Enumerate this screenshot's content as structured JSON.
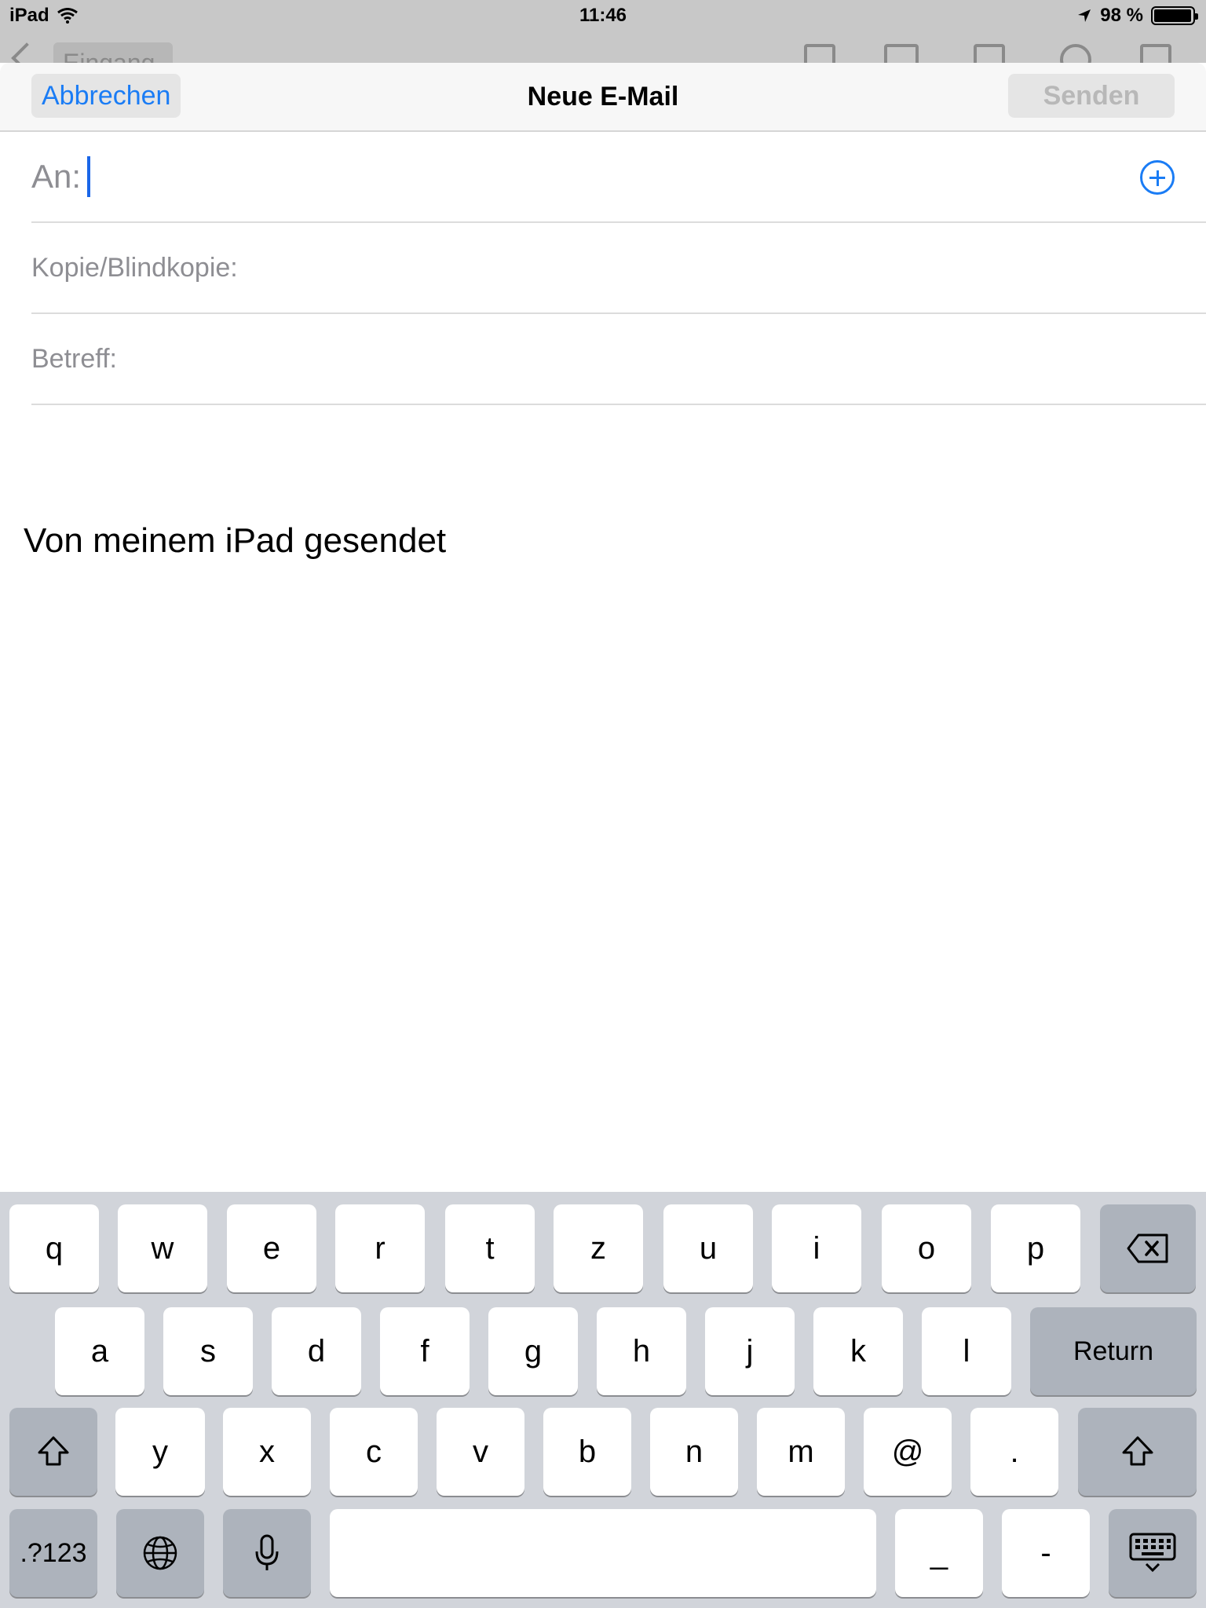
{
  "status_bar": {
    "device": "iPad",
    "time": "11:46",
    "battery_text": "98 %",
    "battery_level": 0.98
  },
  "background_toolbar": {
    "inbox_label": "Eingang"
  },
  "compose": {
    "cancel_label": "Abbrechen",
    "title": "Neue E-Mail",
    "send_label": "Senden",
    "to_label": "An:",
    "to_value": "",
    "cc_label": "Kopie/Blindkopie:",
    "cc_value": "",
    "subject_label": "Betreff:",
    "subject_value": "",
    "signature": "Von meinem iPad gesendet"
  },
  "keyboard": {
    "row1": [
      "q",
      "w",
      "e",
      "r",
      "t",
      "z",
      "u",
      "i",
      "o",
      "p"
    ],
    "row2": [
      "a",
      "s",
      "d",
      "f",
      "g",
      "h",
      "j",
      "k",
      "l"
    ],
    "return_label": "Return",
    "row3": [
      "y",
      "x",
      "c",
      "v",
      "b",
      "n",
      "m",
      "@",
      "."
    ],
    "numbers_label": ".?123",
    "underscore_label": "_",
    "dash_label": "-"
  },
  "colors": {
    "accent": "#1a7cf5",
    "keyboard_bg": "#d1d4da",
    "function_key": "#adb3bc"
  }
}
